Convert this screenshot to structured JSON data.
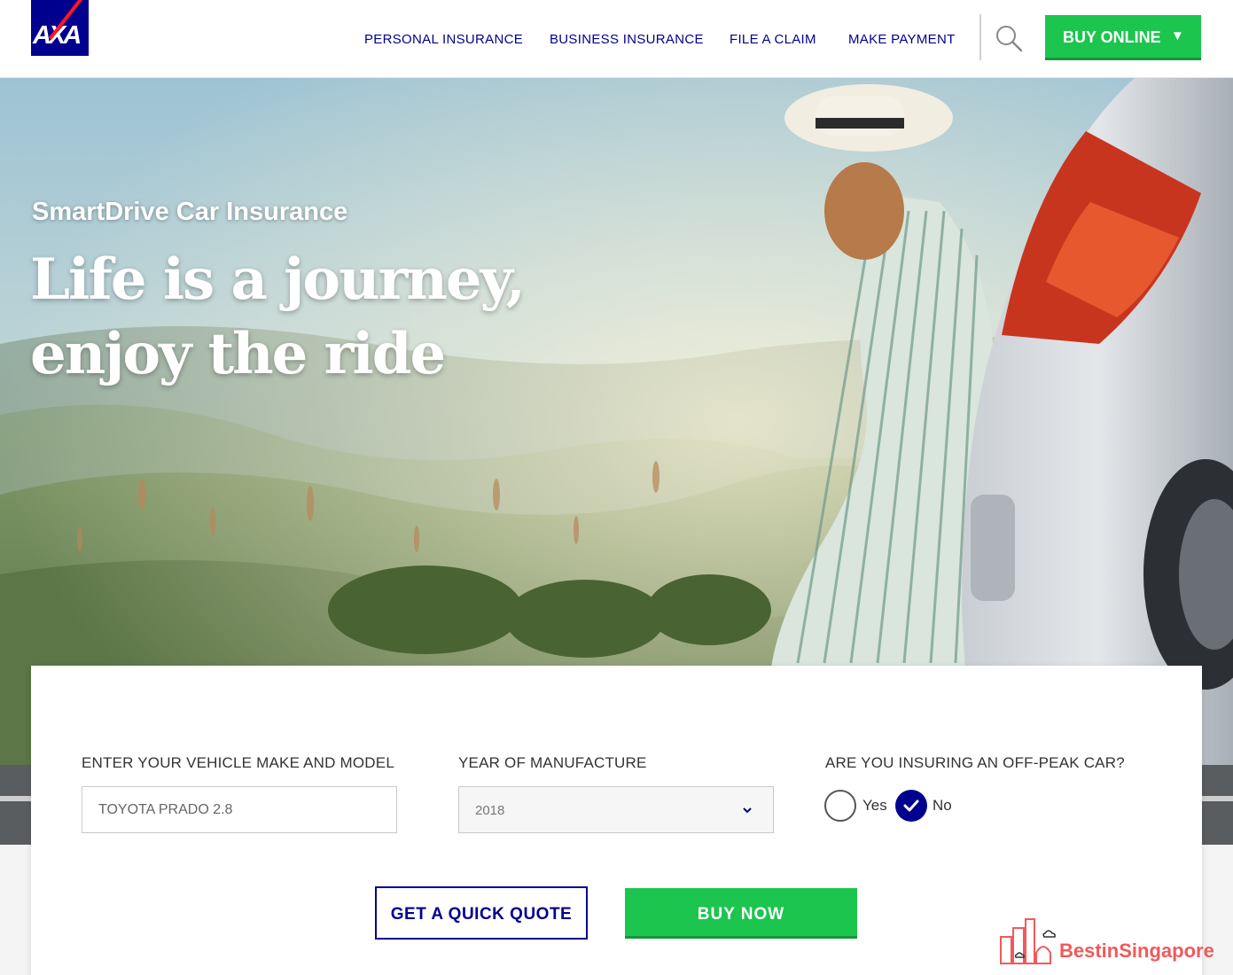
{
  "brand": {
    "logo_text": "AXA",
    "logo_color": "#00008f",
    "accent_red": "#ff1721",
    "green": "#1cc54e"
  },
  "nav": {
    "items": [
      {
        "label": "PERSONAL INSURANCE"
      },
      {
        "label": "BUSINESS INSURANCE"
      },
      {
        "label": "FILE A CLAIM"
      },
      {
        "label": "MAKE PAYMENT"
      }
    ],
    "search_icon": "search-icon",
    "buy_online": {
      "label": "BUY ONLINE",
      "caret": "▼"
    }
  },
  "hero": {
    "kicker": "SmartDrive Car Insurance",
    "title_line1": "Life is a journey,",
    "title_line2": "enjoy the ride"
  },
  "form": {
    "vehicle": {
      "label": "ENTER YOUR VEHICLE MAKE AND MODEL",
      "value": "TOYOTA PRADO 2.8"
    },
    "year": {
      "label": "YEAR OF MANUFACTURE",
      "value": "2018"
    },
    "offpeak": {
      "label": "ARE YOU INSURING AN OFF-PEAK CAR?",
      "options": [
        {
          "label": "Yes",
          "selected": false
        },
        {
          "label": "No",
          "selected": true
        }
      ]
    },
    "quote_button": "GET A QUICK QUOTE",
    "buy_button": "BUY NOW"
  },
  "watermark": {
    "text": "BestinSingapore"
  }
}
